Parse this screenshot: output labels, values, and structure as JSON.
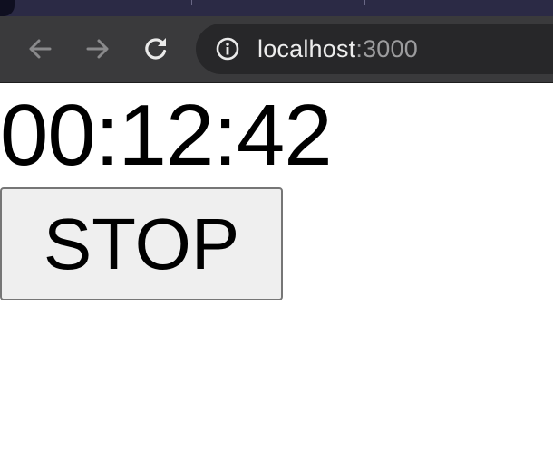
{
  "browser": {
    "url_host": "localhost",
    "url_port": ":3000",
    "icons": {
      "back": "arrow-left-icon",
      "forward": "arrow-right-icon",
      "reload": "reload-icon",
      "site_info": "info-circle-icon"
    }
  },
  "page": {
    "timer": "00:12:42",
    "stop_label": "STOP"
  }
}
